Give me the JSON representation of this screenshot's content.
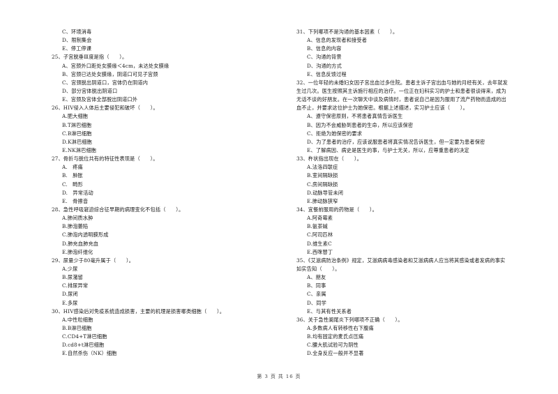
{
  "left_column": {
    "carryover_options": [
      "C、环境消毒",
      "D、限制集会",
      "E、停工停课"
    ],
    "questions": [
      {
        "stem": "25、子宫脱垂Ⅲ度是指（　　）。",
        "options": [
          "A、宫颈外口距处女膜缘＜4cm，未达处女膜缘",
          "B、宫颈已达处女膜缘，阴道口可见子宫颈",
          "C、宫颈脱出阴道口，宫体仍在阴道内",
          "D、部分宫体脱出阴道口",
          "E、宫颈及宫体全部脱出阴道口外"
        ]
      },
      {
        "stem": "26、HIV侵入人体后主要侵犯和破坏（　　）。",
        "options": [
          "A.肥大细胞",
          "B.T淋巴细胞",
          "C.B淋巴细胞",
          "D.K淋巴细胞",
          "E.NK淋巴细胞"
        ]
      },
      {
        "stem": "27、骨折与脱位共有的特征性表现是（　　）。",
        "options": [
          "A.　疼痛",
          "B.　肿胀",
          "C.　畸形",
          "D.　异常活动",
          "E.　骨擦音"
        ]
      },
      {
        "stem": "28、急性呼吸窘迫综合征早期的病理变化不包括（　　）。",
        "options": [
          "A.肺间质水肿",
          "B.肺泡萎陷",
          "C.肺泡内透明膜形成",
          "D.肺充血肺充血",
          "E.肺泡纤维化"
        ]
      },
      {
        "stem": "29、尿量少于80毫升属于（　　）。",
        "options": [
          "A.少尿",
          "B.尿潴留",
          "C.排尿异常",
          "D.尿闭",
          "E.多尿"
        ]
      },
      {
        "stem": "30、HIV感染后对免疫系统造成损害，主要的机理是损害哪类细胞（　　）。",
        "options": [
          "A.中性粒细胞",
          "B.B淋巴细胞",
          "C.CD4+T淋巴细胞",
          "D.cd8+t淋巴细胞",
          "E.自然杀伤（NK）细胞"
        ]
      }
    ]
  },
  "right_column": {
    "questions": [
      {
        "stem_lines": [
          "31、下列哪项不是沟通的基本因素（　　）。"
        ],
        "options": [
          "A、信息的发现者和接受者",
          "B、信息的内容",
          "C、沟通的背景",
          "D、沟通的方式",
          "E、信息反馈过程"
        ]
      },
      {
        "stem_lines": [
          "32、一位年轻的未婚妇女因子宫出血过多住院。患者主诉子宫出血与她的月经有关，去年就发",
          "生过几次。医生按照其主诉施行相应的治疗。一位正在妇科实习的护士和患者很谈得来，成为",
          "无话不谈的好朋友。在一次聊天中谈及病情时，患者说自己是因为服用了流产药物而造成的出",
          "血不止，并要求这位护士为她保密。根据上述描述，实习护士应该（　　）。"
        ],
        "options": [
          "A、遵守保密原则，不将患者真情告诉医生",
          "B、因为不会威胁到患者的生命，所以应该保密",
          "C、拒绝为她保密的要求",
          "D、为了患者的治疗，应该说服患者将真实情况告诉医生，但一定要为患者保密",
          "E、了解病因、病史是医生的事，与护士无关，所以，应尊重患者的决定"
        ]
      },
      {
        "stem_lines": [
          "33、杵状指出现在（　　）。"
        ],
        "options": [
          "A.法洛四联症",
          "B.室间隔缺损",
          "C.房间隔缺损",
          "D.动脉导管未闭",
          "E.肺动脉狭窄"
        ]
      },
      {
        "stem_lines": [
          "34、宜餐前服用的药物是（　　）。"
        ],
        "options": [
          "A.阿奇霉素",
          "B.氨茶碱",
          "C.阿司匹林",
          "D.维生素C",
          "E.西咪替丁"
        ]
      },
      {
        "stem_lines": [
          "35、《艾滋病防治条例》规定，艾滋病病毒感染者和艾滋病病人应当将其感染或者发病的事实",
          "如实告知（　　）。"
        ],
        "options": [
          "A、朋友",
          "B、同事",
          "C、亲属",
          "D、同学",
          "E、与其有性关系者"
        ]
      },
      {
        "stem_lines": [
          "36、关于急性阑尾炎下列哪项不正确（　　）。"
        ],
        "options": [
          "A.多数病人有转移性右下腹痛",
          "B.均有固定的麦氏点压痛",
          "C.腰大肌试验可为阴性",
          "D.全身反应一般并不显著"
        ]
      }
    ]
  },
  "footer": {
    "page_label": "第 3 页 共 16 页"
  }
}
